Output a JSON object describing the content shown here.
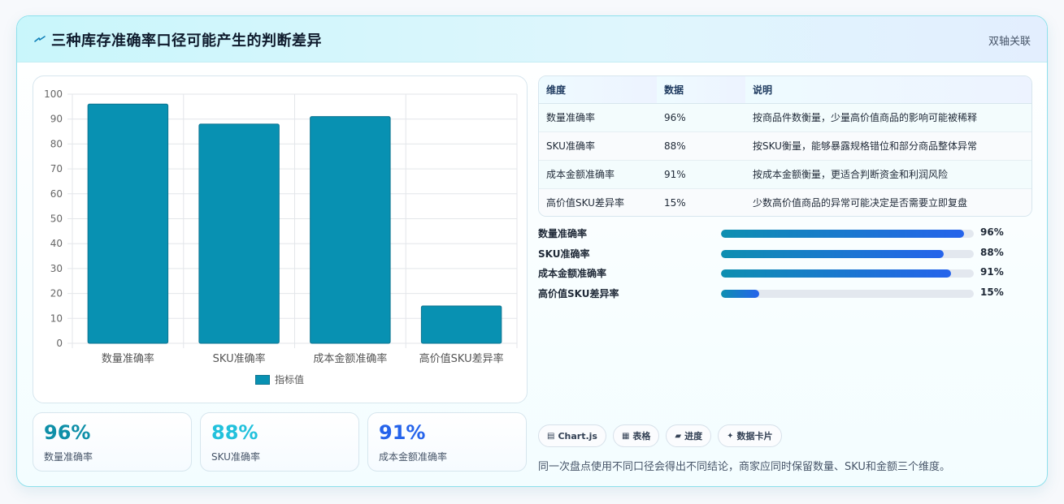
{
  "header": {
    "icon": "lightning-icon",
    "title": "三种库存准确率口径可能产生的判断差异",
    "tag": "双轴关联"
  },
  "chart_data": {
    "type": "bar",
    "categories": [
      "数量准确率",
      "SKU准确率",
      "成本金额准确率",
      "高价值SKU差异率"
    ],
    "series": [
      {
        "name": "指标值",
        "values": [
          96,
          88,
          91,
          15
        ]
      }
    ],
    "ylim": [
      0,
      100
    ],
    "yticks": [
      0,
      10,
      20,
      30,
      40,
      50,
      60,
      70,
      80,
      90,
      100
    ],
    "grid": true,
    "legend_position": "bottom",
    "bar_color": "#0891b2"
  },
  "kpis": [
    {
      "value": "96%",
      "label": "数量准确率",
      "color": "#0e8fa8"
    },
    {
      "value": "88%",
      "label": "SKU准确率",
      "color": "#22c1dc"
    },
    {
      "value": "91%",
      "label": "成本金额准确率",
      "color": "#2563eb"
    }
  ],
  "table": {
    "headers": [
      "维度",
      "数据",
      "说明"
    ],
    "rows": [
      [
        "数量准确率",
        "96%",
        "按商品件数衡量，少量高价值商品的影响可能被稀释"
      ],
      [
        "SKU准确率",
        "88%",
        "按SKU衡量，能够暴露规格错位和部分商品整体异常"
      ],
      [
        "成本金额准确率",
        "91%",
        "按成本金额衡量，更适合判断资金和利润风险"
      ],
      [
        "高价值SKU差异率",
        "15%",
        "少数高价值商品的异常可能决定是否需要立即复盘"
      ]
    ]
  },
  "progress": [
    {
      "label": "数量准确率",
      "value": 96,
      "display": "96%"
    },
    {
      "label": "SKU准确率",
      "value": 88,
      "display": "88%"
    },
    {
      "label": "成本金额准确率",
      "value": 91,
      "display": "91%"
    },
    {
      "label": "高价值SKU差异率",
      "value": 15,
      "display": "15%"
    }
  ],
  "chips": [
    {
      "icon": "chart-icon",
      "glyph": "▤",
      "label": "Chart.js"
    },
    {
      "icon": "table-icon",
      "glyph": "▦",
      "label": "表格"
    },
    {
      "icon": "progress-icon",
      "glyph": "▰",
      "label": "进度"
    },
    {
      "icon": "sparkle-icon",
      "glyph": "✦",
      "label": "数据卡片"
    }
  ],
  "note": "同一次盘点使用不同口径会得出不同结论，商家应同时保留数量、SKU和金额三个维度。"
}
